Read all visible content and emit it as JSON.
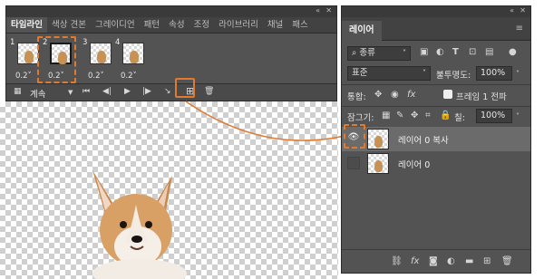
{
  "timeline": {
    "tabs": [
      {
        "label": "타임라인",
        "active": true
      },
      {
        "label": "색상 견본"
      },
      {
        "label": "그레이디언"
      },
      {
        "label": "패턴"
      },
      {
        "label": "속성"
      },
      {
        "label": "조정"
      },
      {
        "label": "라이브러리"
      },
      {
        "label": "채널"
      },
      {
        "label": "패스"
      }
    ],
    "frames": [
      {
        "number": "1",
        "delay": "0.2"
      },
      {
        "number": "2",
        "delay": "0.2"
      },
      {
        "number": "3",
        "delay": "0.2"
      },
      {
        "number": "4",
        "delay": "0.2"
      }
    ],
    "loop_value": "계속",
    "collapse_glyph": "«",
    "close_glyph": "✕",
    "icons": {
      "loop_options": "settings-icon",
      "first_frame": "first-frame-icon",
      "prev_frame": "previous-frame-icon",
      "play": "play-icon",
      "next_frame": "next-frame-icon",
      "tween": "tween-icon",
      "duplicate": "duplicate-frame-icon",
      "delete": "trash-icon"
    }
  },
  "layers": {
    "tab_label": "레이어",
    "filter_value": "종류",
    "blend_mode": "표준",
    "opacity_label": "불투명도:",
    "opacity_value": "100%",
    "unify_label": "통합:",
    "propagate_label": "프레임 1 전파",
    "lock_label": "잠그기:",
    "fill_label": "칠:",
    "fill_value": "100%",
    "items": [
      {
        "name": "레이어 0 복사",
        "visible": true,
        "active": true
      },
      {
        "name": "레이어 0",
        "visible": false,
        "active": false
      }
    ],
    "collapse_glyph": "«",
    "close_glyph": "✕",
    "menu_glyph": "≡"
  },
  "accent_color": "#e07a2e"
}
